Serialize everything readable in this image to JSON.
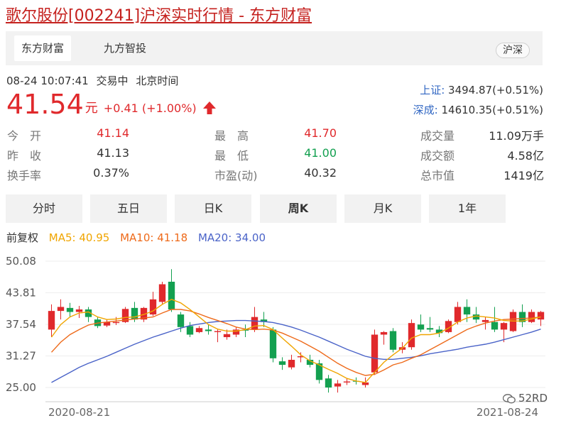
{
  "page": {
    "title": "歌尔股份[002241]沪深实时行情 - 东方财富"
  },
  "source_tabs": [
    "东方财富",
    "九方智投"
  ],
  "market_pill": "沪深",
  "status": {
    "datetime": "08-24 10:07:41",
    "state": "交易中",
    "timezone": "北京时间"
  },
  "quote": {
    "price": "41.54",
    "unit": "元",
    "change": "+0.41 (+1.00%)"
  },
  "indices": [
    {
      "name": "上证:",
      "value": "3494.87(+0.51%)"
    },
    {
      "name": "深成:",
      "value": "14610.35(+0.51%)"
    }
  ],
  "stats": [
    {
      "label": "今　开",
      "value": "41.14"
    },
    {
      "label": "最　高",
      "value": "41.70"
    },
    {
      "label": "成交量",
      "value": "11.09万手"
    },
    {
      "label": "昨　收",
      "value": "41.13"
    },
    {
      "label": "最　低",
      "value": "41.00"
    },
    {
      "label": "成交额",
      "value": "4.58亿"
    },
    {
      "label": "换手率",
      "value": "0.37%"
    },
    {
      "label": "市盈(动)",
      "value": "40.32"
    },
    {
      "label": "总市值",
      "value": "1419亿"
    }
  ],
  "period_tabs": [
    "分时",
    "五日",
    "日K",
    "周K",
    "月K",
    "1年"
  ],
  "active_period": "周K",
  "ma": {
    "adjust": "前复权",
    "ma5": "MA5: 40.95",
    "ma10": "MA10: 41.18",
    "ma20": "MA20: 34.00"
  },
  "colors": {
    "up": "#e0292c",
    "down": "#13a050",
    "ma5": "#f0a500",
    "ma10": "#ee6a1a",
    "ma20": "#4a63c8",
    "index_name": "#3167c3"
  },
  "watermark": "52RD",
  "chart_data": {
    "type": "candlestick",
    "y_ticks": [
      "50.08",
      "43.81",
      "37.54",
      "31.27",
      "25.00"
    ],
    "ylim": [
      25.0,
      50.08
    ],
    "x_labels": [
      "2020-08-21",
      "2021-08-24"
    ],
    "candles": [
      {
        "o": 36.5,
        "h": 41.5,
        "l": 35.0,
        "c": 40.2
      },
      {
        "o": 40.2,
        "h": 42.5,
        "l": 38.5,
        "c": 41.0
      },
      {
        "o": 40.8,
        "h": 41.8,
        "l": 39.0,
        "c": 40.0
      },
      {
        "o": 40.0,
        "h": 41.2,
        "l": 38.8,
        "c": 40.5
      },
      {
        "o": 40.5,
        "h": 41.0,
        "l": 38.0,
        "c": 39.0
      },
      {
        "o": 38.5,
        "h": 39.0,
        "l": 36.8,
        "c": 37.2
      },
      {
        "o": 37.3,
        "h": 38.5,
        "l": 37.0,
        "c": 38.0
      },
      {
        "o": 37.8,
        "h": 39.0,
        "l": 37.4,
        "c": 38.0
      },
      {
        "o": 38.0,
        "h": 41.0,
        "l": 37.8,
        "c": 40.6
      },
      {
        "o": 40.8,
        "h": 42.0,
        "l": 38.0,
        "c": 38.5
      },
      {
        "o": 38.5,
        "h": 41.0,
        "l": 38.0,
        "c": 40.8
      },
      {
        "o": 39.5,
        "h": 44.0,
        "l": 39.2,
        "c": 42.5
      },
      {
        "o": 42.0,
        "h": 46.0,
        "l": 41.5,
        "c": 45.5
      },
      {
        "o": 46.0,
        "h": 48.5,
        "l": 40.0,
        "c": 40.5
      },
      {
        "o": 39.5,
        "h": 40.0,
        "l": 36.0,
        "c": 37.0
      },
      {
        "o": 37.2,
        "h": 38.0,
        "l": 35.0,
        "c": 35.5
      },
      {
        "o": 36.0,
        "h": 37.2,
        "l": 35.8,
        "c": 36.8
      },
      {
        "o": 36.5,
        "h": 37.5,
        "l": 35.5,
        "c": 36.2
      },
      {
        "o": 36.0,
        "h": 36.5,
        "l": 34.0,
        "c": 36.2
      },
      {
        "o": 35.0,
        "h": 36.5,
        "l": 34.5,
        "c": 35.6
      },
      {
        "o": 35.5,
        "h": 37.0,
        "l": 35.0,
        "c": 36.5
      },
      {
        "o": 36.5,
        "h": 37.5,
        "l": 35.0,
        "c": 36.3
      },
      {
        "o": 36.5,
        "h": 41.0,
        "l": 36.0,
        "c": 39.0
      },
      {
        "o": 38.5,
        "h": 40.0,
        "l": 37.0,
        "c": 38.0
      },
      {
        "o": 36.5,
        "h": 37.0,
        "l": 30.0,
        "c": 30.8
      },
      {
        "o": 30.2,
        "h": 31.0,
        "l": 28.5,
        "c": 29.5
      },
      {
        "o": 29.0,
        "h": 31.5,
        "l": 28.6,
        "c": 30.5
      },
      {
        "o": 31.0,
        "h": 32.0,
        "l": 30.0,
        "c": 31.2
      },
      {
        "o": 30.5,
        "h": 31.5,
        "l": 29.0,
        "c": 29.5
      },
      {
        "o": 29.8,
        "h": 30.5,
        "l": 25.8,
        "c": 26.5
      },
      {
        "o": 26.8,
        "h": 27.5,
        "l": 24.0,
        "c": 25.0
      },
      {
        "o": 25.2,
        "h": 26.5,
        "l": 24.0,
        "c": 25.8
      },
      {
        "o": 26.0,
        "h": 26.8,
        "l": 25.5,
        "c": 26.2
      },
      {
        "o": 26.3,
        "h": 27.0,
        "l": 25.6,
        "c": 26.2
      },
      {
        "o": 25.5,
        "h": 27.0,
        "l": 25.0,
        "c": 26.0
      },
      {
        "o": 28.0,
        "h": 36.5,
        "l": 27.5,
        "c": 35.5
      },
      {
        "o": 35.5,
        "h": 36.2,
        "l": 33.5,
        "c": 36.0
      },
      {
        "o": 36.2,
        "h": 36.8,
        "l": 32.0,
        "c": 32.5
      },
      {
        "o": 32.5,
        "h": 34.0,
        "l": 31.8,
        "c": 33.0
      },
      {
        "o": 33.0,
        "h": 38.5,
        "l": 32.5,
        "c": 37.8
      },
      {
        "o": 37.5,
        "h": 39.5,
        "l": 36.0,
        "c": 36.5
      },
      {
        "o": 36.8,
        "h": 39.0,
        "l": 36.0,
        "c": 36.5
      },
      {
        "o": 36.5,
        "h": 37.2,
        "l": 35.0,
        "c": 35.8
      },
      {
        "o": 36.0,
        "h": 38.5,
        "l": 35.8,
        "c": 38.2
      },
      {
        "o": 38.0,
        "h": 42.0,
        "l": 37.5,
        "c": 41.0
      },
      {
        "o": 41.0,
        "h": 42.5,
        "l": 38.0,
        "c": 39.5
      },
      {
        "o": 39.5,
        "h": 41.0,
        "l": 37.8,
        "c": 38.5
      },
      {
        "o": 38.0,
        "h": 39.0,
        "l": 36.5,
        "c": 38.4
      },
      {
        "o": 38.0,
        "h": 41.0,
        "l": 36.0,
        "c": 36.5
      },
      {
        "o": 36.5,
        "h": 38.0,
        "l": 34.0,
        "c": 37.8
      },
      {
        "o": 36.2,
        "h": 40.5,
        "l": 36.0,
        "c": 40.0
      },
      {
        "o": 40.0,
        "h": 41.5,
        "l": 37.0,
        "c": 38.0
      },
      {
        "o": 38.0,
        "h": 40.5,
        "l": 37.8,
        "c": 40.0
      },
      {
        "o": 38.5,
        "h": 40.2,
        "l": 37.2,
        "c": 40.0
      }
    ],
    "ma5": [
      35.0,
      37.5,
      39.0,
      39.8,
      40.0,
      39.0,
      38.5,
      38.6,
      38.9,
      39.0,
      39.5,
      40.2,
      41.5,
      42.5,
      41.8,
      40.5,
      39.0,
      37.5,
      36.6,
      36.2,
      36.2,
      36.5,
      37.2,
      37.3,
      36.5,
      34.8,
      33.2,
      31.5,
      30.3,
      29.5,
      28.6,
      27.8,
      26.8,
      26.3,
      26.0,
      28.0,
      30.0,
      31.5,
      32.8,
      34.8,
      35.5,
      35.5,
      35.8,
      36.8,
      38.0,
      38.8,
      39.2,
      39.0,
      38.8,
      38.3,
      38.2,
      38.2,
      38.6,
      39.0
    ],
    "ma10": [
      32.0,
      34.0,
      35.5,
      36.5,
      37.4,
      37.8,
      38.0,
      38.2,
      38.4,
      38.6,
      38.8,
      39.0,
      39.8,
      40.5,
      40.5,
      40.2,
      39.6,
      38.9,
      38.3,
      37.7,
      37.0,
      36.6,
      36.5,
      36.6,
      36.4,
      35.8,
      35.0,
      34.2,
      33.2,
      32.2,
      31.0,
      29.8,
      28.8,
      28.0,
      27.4,
      27.6,
      28.5,
      29.5,
      30.0,
      30.8,
      31.5,
      32.5,
      33.5,
      34.5,
      35.5,
      36.5,
      37.2,
      37.8,
      38.2,
      38.5,
      38.6,
      38.7,
      38.8,
      39.0
    ],
    "ma20": [
      26.0,
      27.0,
      28.0,
      29.0,
      29.8,
      30.5,
      31.2,
      32.0,
      32.8,
      33.6,
      34.3,
      35.0,
      35.6,
      36.2,
      36.8,
      37.3,
      37.6,
      37.9,
      38.1,
      38.2,
      38.3,
      38.3,
      38.2,
      38.1,
      37.9,
      37.5,
      37.0,
      36.4,
      35.7,
      35.0,
      34.2,
      33.4,
      32.6,
      31.9,
      31.2,
      30.8,
      30.6,
      30.6,
      30.8,
      31.0,
      31.3,
      31.7,
      32.0,
      32.3,
      32.6,
      33.0,
      33.3,
      33.6,
      34.0,
      34.5,
      35.0,
      35.5,
      36.0,
      36.6
    ]
  }
}
